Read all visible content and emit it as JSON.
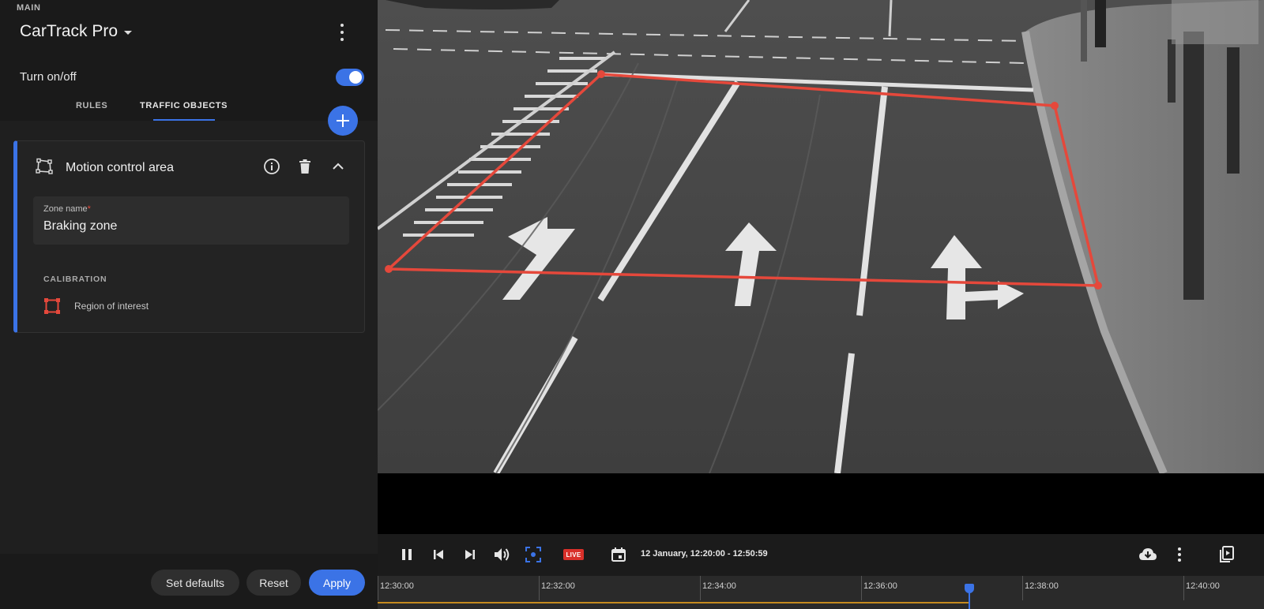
{
  "app": {
    "title": "CarTrack Pro"
  },
  "toggle": {
    "label": "Turn on/off",
    "on": true
  },
  "tabs": [
    {
      "label": "MAIN"
    },
    {
      "label": "RULES"
    },
    {
      "label": "TRAFFIC OBJECTS",
      "active": true
    }
  ],
  "card": {
    "title": "Motion control area",
    "zone_field_label": "Zone name",
    "zone_required_mark": "*",
    "zone_value": "Braking zone",
    "calibration_label": "CALIBRATION",
    "roi_label": "Region of interest"
  },
  "footer": {
    "set_defaults": "Set defaults",
    "reset": "Reset",
    "apply": "Apply"
  },
  "player": {
    "live_label": "LIVE",
    "date_range": "12 January, 12:20:00 - 12:50:59",
    "ticks": [
      "12:30:00",
      "12:32:00",
      "12:34:00",
      "12:36:00",
      "12:38:00",
      "12:40:00"
    ]
  },
  "colors": {
    "accent": "#3b73e6",
    "zone_outline": "#e5483b",
    "live": "#d9302a",
    "progress": "#c58a1f"
  }
}
